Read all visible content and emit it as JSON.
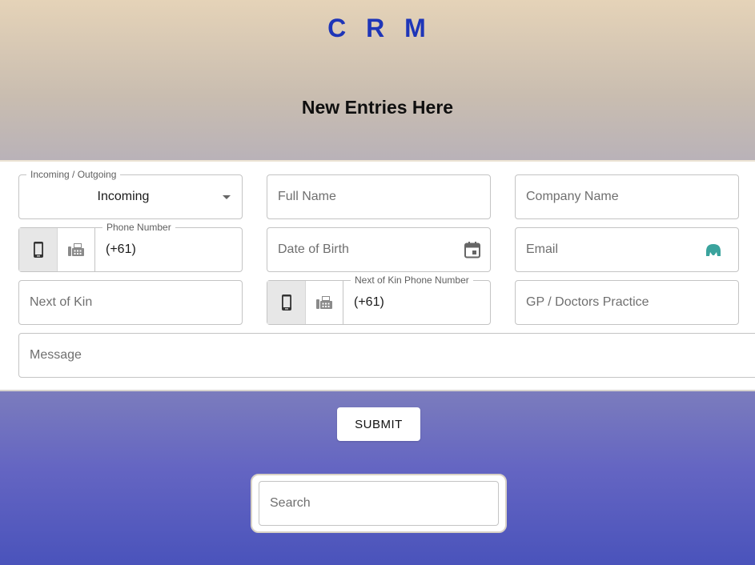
{
  "header": {
    "brand": "C R M",
    "subtitle": "New Entries Here"
  },
  "form": {
    "direction": {
      "legend": "Incoming / Outgoing",
      "value": "Incoming"
    },
    "full_name": {
      "placeholder": "Full Name"
    },
    "company_name": {
      "placeholder": "Company Name"
    },
    "phone": {
      "legend": "Phone Number",
      "value": "(+61)",
      "toggle": [
        "mobile-icon",
        "fax-icon"
      ]
    },
    "date_of_birth": {
      "placeholder": "Date of Birth",
      "icon": "calendar-icon"
    },
    "email": {
      "placeholder": "Email",
      "icon": "extension-icon"
    },
    "next_of_kin": {
      "placeholder": "Next of Kin"
    },
    "kin_phone": {
      "legend": "Next of Kin Phone Number",
      "value": "(+61)",
      "toggle": [
        "mobile-icon",
        "fax-icon"
      ]
    },
    "gp": {
      "placeholder": "GP / Doctors Practice"
    },
    "message": {
      "placeholder": "Message"
    }
  },
  "actions": {
    "submit_label": "SUBMIT"
  },
  "search": {
    "placeholder": "Search"
  },
  "colors": {
    "brand": "#1e35b8",
    "extension_icon": "#3aa39d"
  }
}
